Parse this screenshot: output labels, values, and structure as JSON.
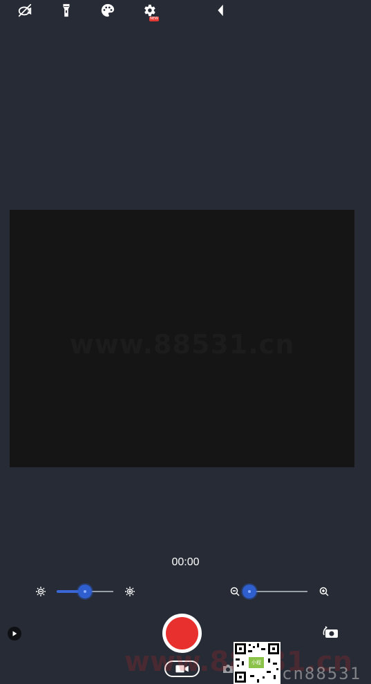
{
  "toolbar": {
    "icons": [
      "camera-off-icon",
      "flashlight-icon",
      "palette-icon",
      "settings-icon",
      "back-triangle-icon"
    ],
    "settings_badge": "NEW"
  },
  "preview": {
    "watermark_text": "www.88531.cn"
  },
  "timer": "00:00",
  "brightness_slider": {
    "level_fraction": 0.5,
    "min_icon": "brightness-low-icon",
    "max_icon": "brightness-high-icon"
  },
  "zoom_slider": {
    "level_fraction": 0.08,
    "min_icon": "zoom-out-icon",
    "max_icon": "zoom-in-icon"
  },
  "bottom": {
    "record_color": "#e8302e",
    "mode_icon": "video-camera-icon",
    "switch_camera_icon": "switch-camera-icon",
    "qr_badge": "小程",
    "watermark_text": "www.88531.cn",
    "watermark_right": "cn88531"
  },
  "colors": {
    "background": "#262b35",
    "accent": "#2f5fcf",
    "preview": "#151515"
  }
}
